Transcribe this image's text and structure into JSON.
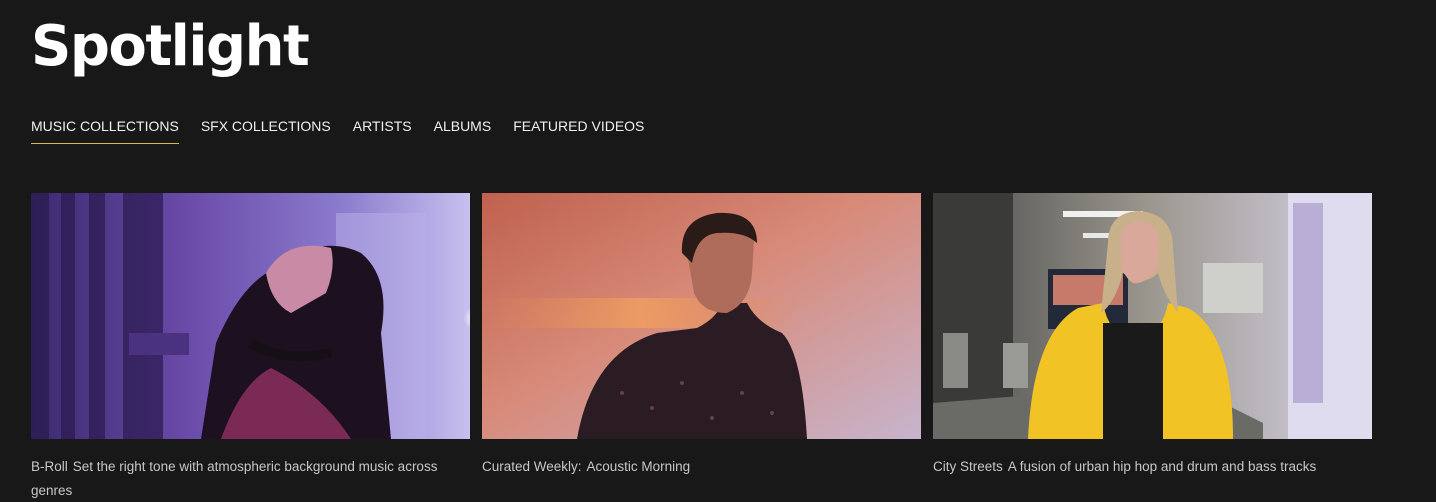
{
  "header": {
    "title": "Spotlight"
  },
  "tabs": [
    {
      "label": "MUSIC COLLECTIONS",
      "active": true
    },
    {
      "label": "SFX COLLECTIONS",
      "active": false
    },
    {
      "label": "ARTISTS",
      "active": false
    },
    {
      "label": "ALBUMS",
      "active": false
    },
    {
      "label": "FEATURED VIDEOS",
      "active": false
    }
  ],
  "accent_color": "#d8b944",
  "cards": [
    {
      "name": "B-Roll",
      "description": "Set the right tone with atmospheric background music across genres",
      "image": "woman-neon-light-photo"
    },
    {
      "name": "Curated Weekly:",
      "description": "Acoustic Morning",
      "image": "man-warm-gradient-photo"
    },
    {
      "name": "City Streets",
      "description": "A fusion of urban hip hop and drum and bass tracks",
      "image": "woman-yellow-jacket-diner-photo"
    }
  ]
}
